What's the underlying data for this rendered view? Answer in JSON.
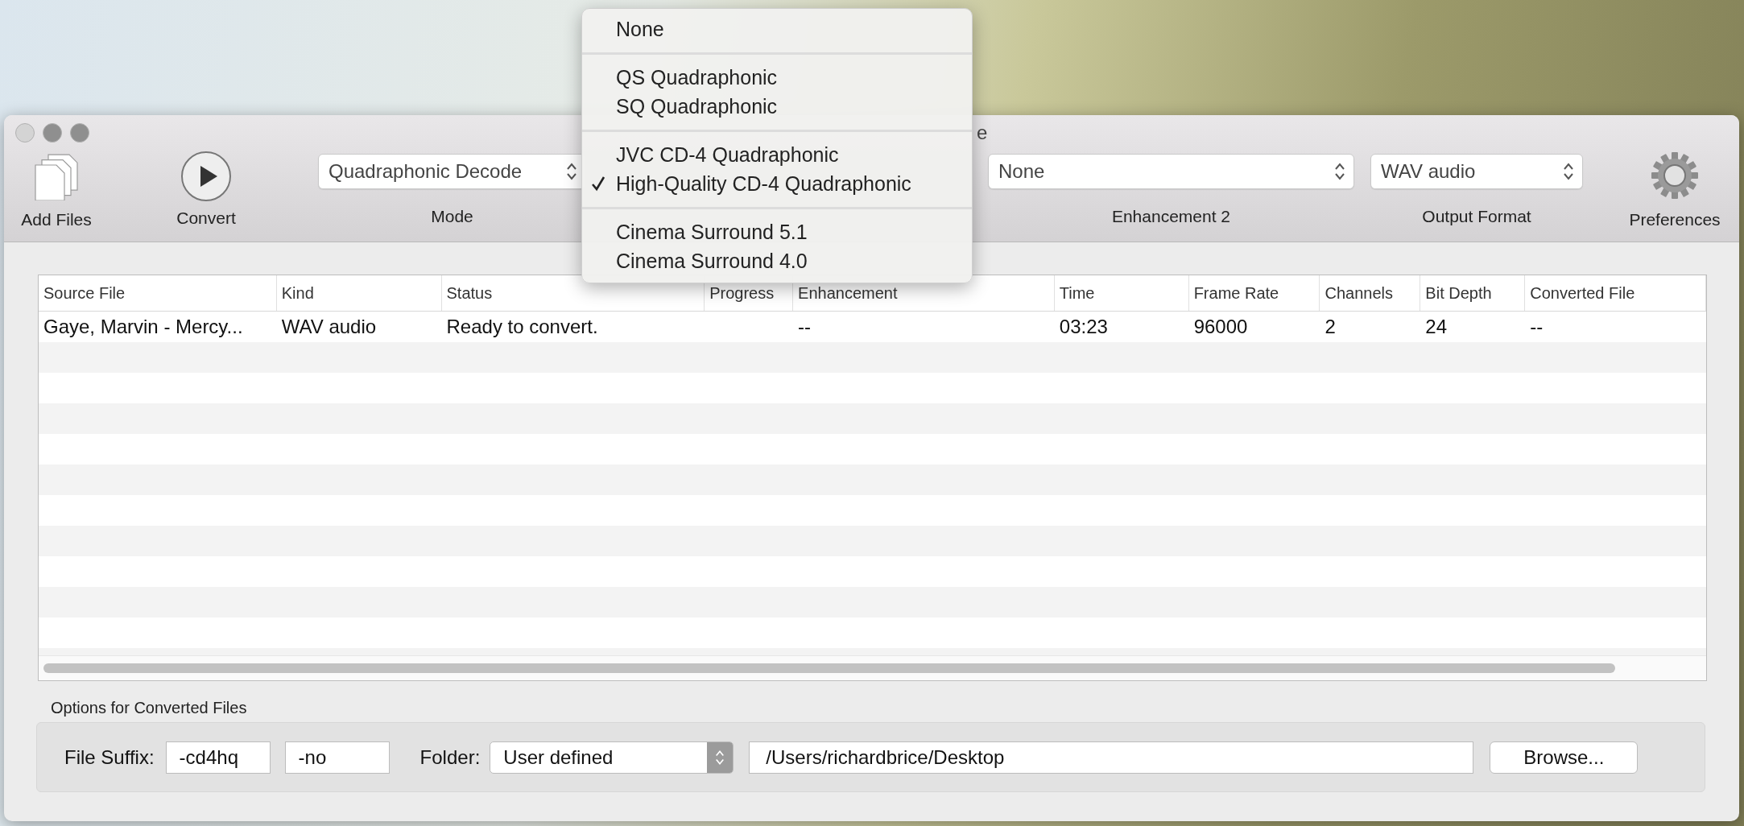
{
  "window": {
    "title": "e"
  },
  "toolbar": {
    "buttons": [
      {
        "label": "Add Files",
        "kind": "files"
      },
      {
        "label": "Convert",
        "kind": "play"
      }
    ],
    "popups": [
      {
        "label": "Mode",
        "value": "Quadraphonic Decode"
      },
      {
        "label": "Enhancement 2",
        "value": "None"
      },
      {
        "label": "Output Format",
        "value": "WAV audio"
      }
    ],
    "preferences": {
      "label": "Preferences"
    }
  },
  "popup_menu": {
    "groups": [
      {
        "items": [
          {
            "label": "None",
            "checked": false
          }
        ]
      },
      {
        "items": [
          {
            "label": "QS Quadraphonic",
            "checked": false
          },
          {
            "label": "SQ Quadraphonic",
            "checked": false
          }
        ]
      },
      {
        "items": [
          {
            "label": "JVC CD-4 Quadraphonic",
            "checked": false
          },
          {
            "label": "High-Quality CD-4 Quadraphonic",
            "checked": true
          }
        ]
      },
      {
        "items": [
          {
            "label": "Cinema Surround 5.1",
            "checked": false
          },
          {
            "label": "Cinema Surround 4.0",
            "checked": false
          }
        ]
      }
    ]
  },
  "table": {
    "columns": [
      "Source File",
      "Kind",
      "Status",
      "Progress",
      "Enhancement",
      "Time",
      "Frame Rate",
      "Channels",
      "Bit Depth",
      "Converted File"
    ],
    "rows": [
      {
        "cells": [
          "Gaye, Marvin - Mercy...",
          "WAV audio",
          "Ready to convert.",
          "",
          "--",
          "03:23",
          "96000",
          "2",
          "24",
          "--"
        ]
      }
    ]
  },
  "options": {
    "title": "Options for Converted Files",
    "suffix_label": "File Suffix:",
    "suffix_fields": [
      "-cd4hq",
      "-no"
    ],
    "folder_label": "Folder:",
    "folder_value": "User defined",
    "path": "/Users/richardbrice/Desktop",
    "browse": "Browse..."
  }
}
